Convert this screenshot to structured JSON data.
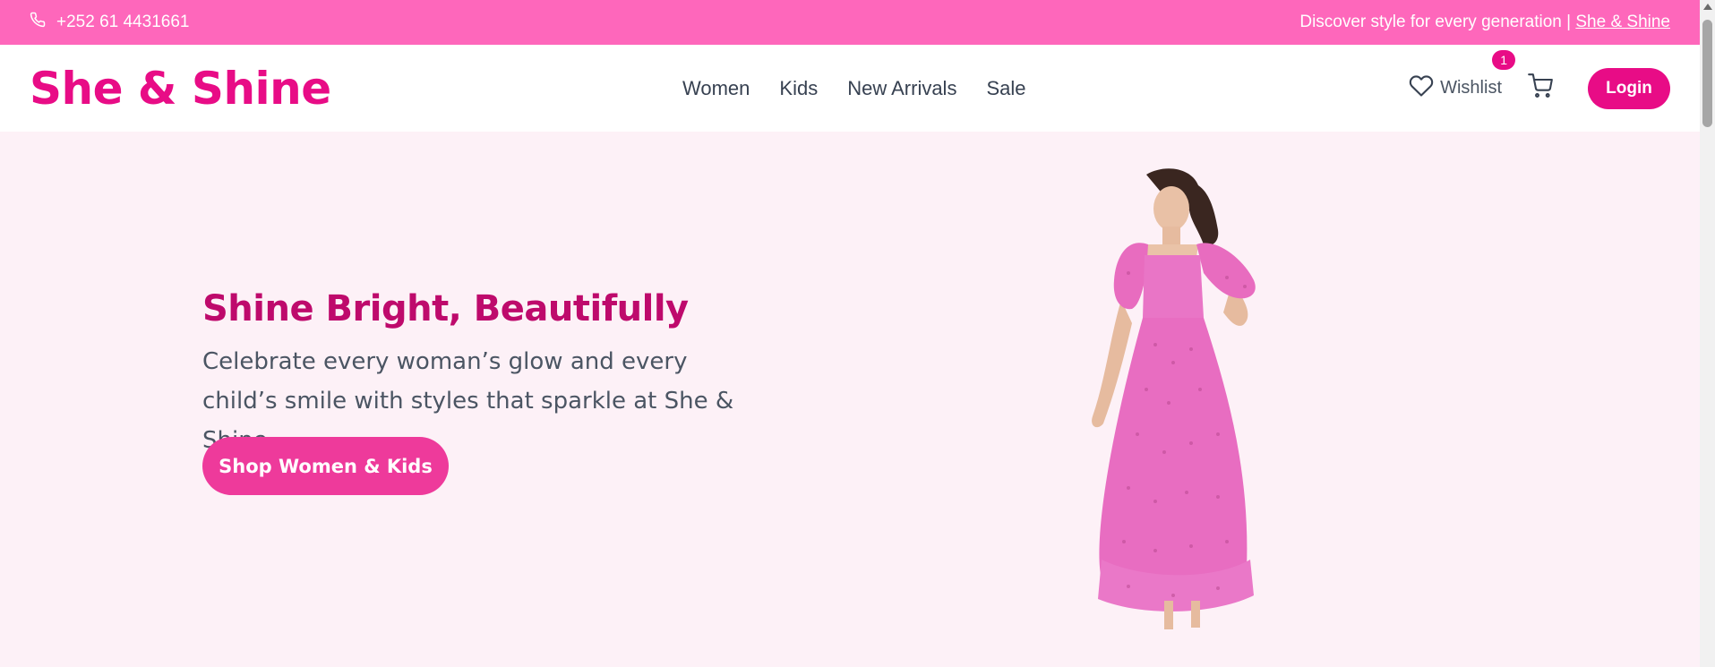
{
  "topbar": {
    "phone": "+252 61 4431661",
    "tagline": "Discover style for every generation | ",
    "brand_link": "She & Shine",
    "phone_icon": "phone-icon"
  },
  "header": {
    "logo": "She & Shine",
    "nav": [
      "Women",
      "Kids",
      "New Arrivals",
      "Sale"
    ],
    "wishlist_label": "Wishlist",
    "wishlist_count": "1",
    "login_label": "Login",
    "icons": [
      "heart-icon",
      "cart-icon"
    ]
  },
  "hero": {
    "title": "Shine Bright, Beautifully",
    "text": "Celebrate every woman’s glow and every child’s smile with styles that sparkle at She & Shine.",
    "button": "Shop Women & Kids"
  },
  "colors": {
    "topbar": "#fe67bb",
    "brand": "#e80c86",
    "hero_bg": "#fdf1f7",
    "dress": "#ea6fc3"
  }
}
